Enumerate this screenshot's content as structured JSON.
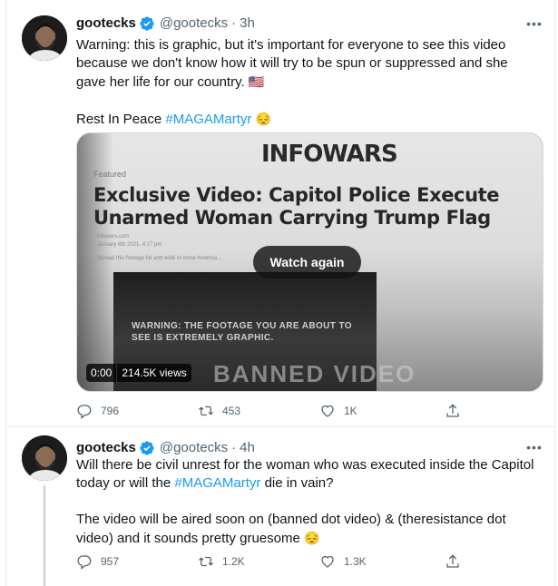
{
  "tweets": [
    {
      "author": {
        "name": "gootecks",
        "handle": "@gootecks",
        "time": "3h"
      },
      "more_label": "•••",
      "body": {
        "line1": "Warning: this is graphic, but it's important for everyone to see this video because we don't know how it will try to be spun or suppressed and she gave her life for our country.",
        "line1_emoji": "🇺🇸",
        "line2_text": "Rest In Peace ",
        "line2_hashtag": "#MAGAMartyr",
        "line2_emoji": "😔"
      },
      "media": {
        "logo": "INFOWARS",
        "featured": "Featured",
        "headline": "Exclusive Video: Capitol Police Execute Unarmed Woman Carrying Trump Flag",
        "meta_site": "infowars.com",
        "meta_date": "January 6th 2021, 4:17 pm",
        "share_line": "Spread this footage far and wide to know America...",
        "warning": "WARNING: THE FOOTAGE YOU ARE ABOUT TO SEE IS EXTREMELY GRAPHIC.",
        "watermark": "BANNED VIDEO",
        "watch_again": "Watch again",
        "duration": "0:00",
        "views": "214.5K views"
      },
      "actions": {
        "replies": "796",
        "retweets": "453",
        "likes": "1K"
      }
    },
    {
      "author": {
        "name": "gootecks",
        "handle": "@gootecks",
        "time": "4h"
      },
      "more_label": "•••",
      "body": {
        "p1_before": "Will there be civil unrest for the woman who was executed inside the Capitol today or will the ",
        "p1_hashtag": "#MAGAMartyr",
        "p1_after": " die in vain?",
        "p2": "The video will be aired soon on (banned dot video) & (theresistance dot video)  and it sounds pretty gruesome ",
        "p2_emoji": "😔"
      },
      "actions": {
        "replies": "957",
        "retweets": "1.2K",
        "likes": "1.3K"
      }
    }
  ],
  "separator": "·",
  "icons": {
    "reply": "reply-icon",
    "retweet": "retweet-icon",
    "like": "heart-icon",
    "share": "share-icon",
    "verified": "verified-badge-icon",
    "more": "more-options-icon"
  },
  "colors": {
    "link": "#1d9bf0",
    "secondary_text": "#536471",
    "verified_badge": "#1d9bf0",
    "border": "#e6ecf0"
  }
}
